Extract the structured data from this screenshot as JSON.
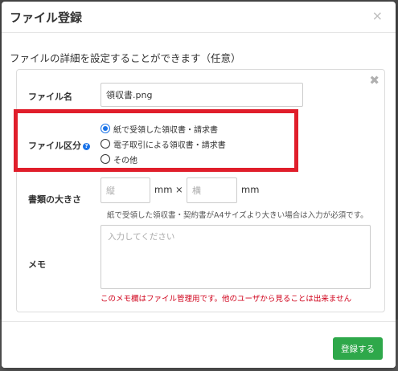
{
  "modal": {
    "title": "ファイル登録",
    "close_icon": "×",
    "description": "ファイルの詳細を設定することができます（任意）"
  },
  "form": {
    "close_icon": "✖",
    "filename": {
      "label": "ファイル名",
      "value": "領収書.png"
    },
    "category": {
      "label": "ファイル区分",
      "help_icon": "?",
      "options": [
        {
          "label": "紙で受領した領収書・請求書",
          "checked": true
        },
        {
          "label": "電子取引による領収書・請求書",
          "checked": false
        },
        {
          "label": "その他",
          "checked": false
        }
      ]
    },
    "size": {
      "label": "書類の大きさ",
      "vertical_placeholder": "縦",
      "horizontal_placeholder": "横",
      "unit1": "mm ×",
      "unit2": "mm",
      "note": "紙で受領した領収書・契約書がA4サイズより大きい場合は入力が必須です。"
    },
    "memo": {
      "label": "メモ",
      "placeholder": "入力してください",
      "note": "このメモ欄はファイル管理用です。他のユーザから見ることは出来ません"
    }
  },
  "footer": {
    "submit_label": "登録する"
  },
  "colors": {
    "highlight": "#e01e2b",
    "accent": "#1a73e8",
    "submit": "#2ea84a",
    "warning": "#d0021b"
  }
}
